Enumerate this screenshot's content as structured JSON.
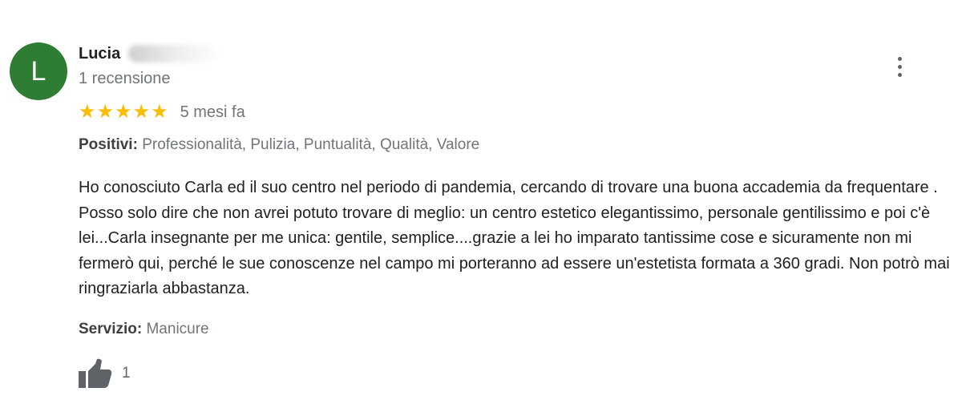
{
  "review": {
    "avatar_letter": "L",
    "avatar_color": "#2e7d32",
    "author_name": "Lucia",
    "author_reviews": "1 recensione",
    "rating": 5,
    "rating_max": 5,
    "stars": [
      "★",
      "★",
      "★",
      "★",
      "★"
    ],
    "time_ago": "5 mesi fa",
    "positives_label": "Positivi:",
    "positives_value": "Professionalità, Pulizia, Puntualità, Qualità, Valore",
    "text": "Ho conosciuto Carla ed il suo centro nel periodo di pandemia, cercando di trovare una buona accademia da frequentare . Posso solo dire che non avrei potuto trovare di meglio: un centro estetico elegantissimo, personale gentilissimo e poi c'è lei...Carla insegnante per me unica: gentile, semplice....grazie a lei ho imparato tantissime cose e sicuramente non mi fermerò qui, perché le sue conoscenze nel campo mi porteranno ad essere un'estetista formata a 360 gradi. Non potrò mai ringraziarla abbastanza.",
    "service_label": "Servizio:",
    "service_value": "Manicure",
    "like_count": "1",
    "icons": {
      "menu": "more-vert-icon",
      "like": "thumb-up-icon",
      "star": "star-icon"
    },
    "colors": {
      "star": "#fbbc04",
      "secondary_text": "#70757a",
      "icon": "#5f6368"
    }
  }
}
